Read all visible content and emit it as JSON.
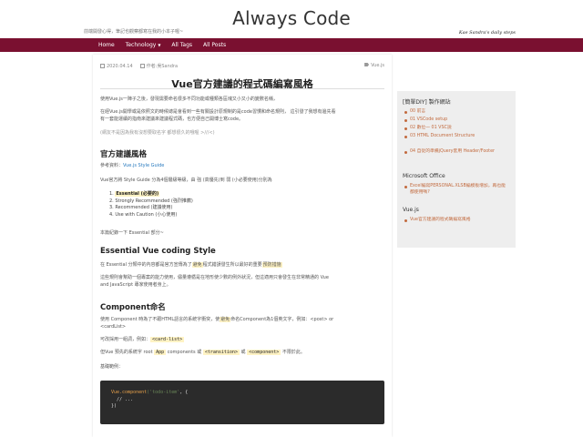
{
  "site": {
    "title": "Always Code",
    "tagline": "前端開發心得，筆記也觀察都寫在我的小本子喔~",
    "signature": "Kae Sandra's daily steps"
  },
  "nav": {
    "items": [
      {
        "label": "Home"
      },
      {
        "label": "Technology",
        "caret": "▼"
      },
      {
        "label": "All Tags"
      },
      {
        "label": "All Posts"
      }
    ]
  },
  "post": {
    "date": "2020.04.14",
    "author": "作者:吳Sandra",
    "tag": "Vue.js",
    "title": "Vue官方建議的程式碼編寫風格",
    "intro1": "使用Vue.js一陣子之後，發現需要命名很多不同功能或種類各區塊又小又小的變數名稱，",
    "intro2a": "在經Vue.js開學或是依照文的時候總是會看到一些有關設計原規制的是code習慣和命名規則， 這引發了我想有邊先看",
    "intro2b": "有一套能運續的指南來建議來建議程式碼，也方便自己開博士寫code。",
    "intro3": "(網友不是因為我有沒想要取名字 都想很久的哦喔 >///<)",
    "h_guide": "官方建議風格",
    "ref_label": "參考資料：",
    "ref_link": "Vue.js Style Guide",
    "guide_desc": "Vue官方將 Style Guide 分為4個層級等級，由 強 (高優先)到 弱 (小必要使用)分別為",
    "list": [
      {
        "num": "1.",
        "text": "Essential (必要的)"
      },
      {
        "num": "2.",
        "text": "Strongly Recommended (強烈推薦)"
      },
      {
        "num": "3.",
        "text": "Recommended (建議使用)"
      },
      {
        "num": "4.",
        "text": "Use with Caution (小心使用)"
      }
    ],
    "intro_part": "本篇紀錄一下 Essential 部分~",
    "h_essential": "Essential Vue coding Style",
    "ess_desc1a": "在 Essential 分類中的內容都是官方宣傳為了",
    "ess_hl1": "避免",
    "ess_desc1b": "程式錯誤發生所以最好的重要",
    "ess_hl2": "預防措施",
    "ess_desc2a": "這些規則會幫助一個專案的能力使用，儘量遵循是在地形使少數的例外狀況，但這適用只會發生在非常精通的 Vue",
    "ess_desc2b": "and JavaScript 專家使用者身上。",
    "h_component": "Component命名",
    "comp_desc1a": "使用 Component 時為了不跟HTML語言的系統字衝突，使",
    "comp_hl": "避免",
    "comp_desc1b": "命名Component為1個英文字，例如：<post> or",
    "comp_desc1c": "<cardList>",
    "comp_desc2a": "可改採用一組詞，例如：",
    "comp_code1": "<card-list>",
    "comp_desc3a": "但Vue 預先的系統字 root",
    "comp_code2": "App",
    "comp_desc3b": "components 或",
    "comp_code3": "<transition>",
    "comp_desc3c": "或",
    "comp_code4": "<component>",
    "comp_desc3d": "不限於此。",
    "sample_label": "基礎範例：",
    "code_line1_fn": "Vue.component",
    "code_line1_str": "('todo-item'",
    "code_line1_end": ", {",
    "code_line2": "  // ...",
    "code_line3": "})"
  },
  "sidebar": {
    "sections": [
      {
        "heading": "[簡單DIY] 製作網站",
        "links": [
          "00 前言",
          "01 VSCode setup",
          "02 數位一 01 VSC說",
          "03 HTML Document Structure",
          "04 自從的準備jQuery套用 Header/Footer"
        ]
      },
      {
        "heading": "Microsoft Office",
        "links": [
          "Excel編寫PERSONAL.XLSB編模板增加，再也能都使用嗎?"
        ]
      },
      {
        "heading": "Vue.js",
        "links": [
          "Vue官方建議的程式碼編寫風格"
        ]
      }
    ]
  },
  "colors": {
    "nav_bg": "#7a1030",
    "sidebar_link": "#c26a3e",
    "link": "#2a7bbf"
  }
}
